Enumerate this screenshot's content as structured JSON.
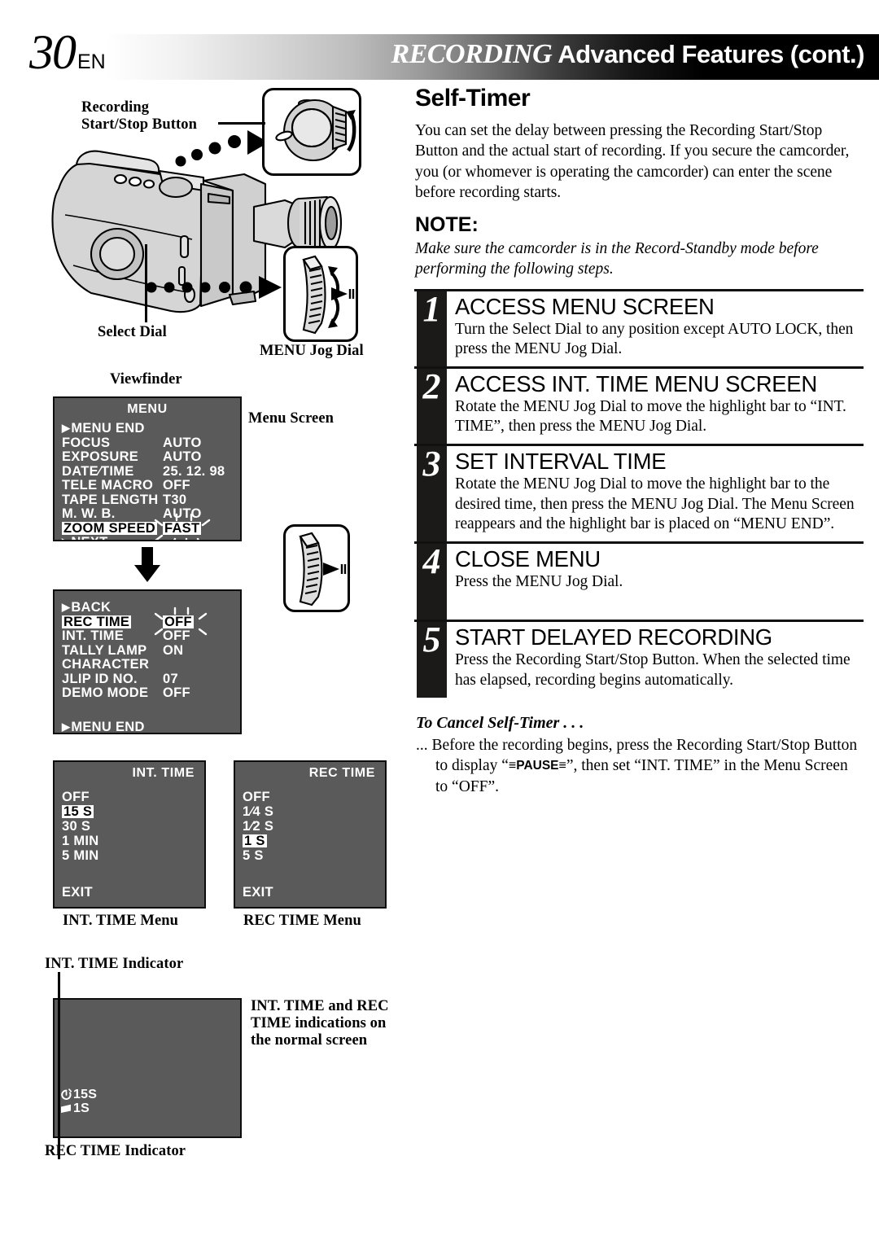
{
  "header": {
    "page_number": "30",
    "language": "EN",
    "title_italic": "RECORDING",
    "title_bold": "Advanced Features (cont.)"
  },
  "left": {
    "labels": {
      "recording_start_stop": "Recording\nStart/Stop Button",
      "select_dial": "Select Dial",
      "menu_jog_dial": "MENU Jog Dial",
      "viewfinder": "Viewfinder",
      "menu_screen": "Menu Screen",
      "int_time_menu": "INT. TIME Menu",
      "rec_time_menu": "REC TIME Menu",
      "int_time_indicator": "INT. TIME Indicator",
      "rec_time_indicator": "REC TIME Indicator",
      "normal_screen_note": "INT. TIME and REC TIME indications on the normal screen"
    }
  },
  "osd": {
    "menu1": {
      "title": "MENU",
      "rows": [
        {
          "name": "MENU END",
          "value": "",
          "arrow": true,
          "highlight": false,
          "blink": false
        },
        {
          "name": "FOCUS",
          "value": "AUTO",
          "arrow": false,
          "highlight": false,
          "blink": false
        },
        {
          "name": "EXPOSURE",
          "value": "AUTO",
          "arrow": false,
          "highlight": false,
          "blink": false
        },
        {
          "name": "DATE∕TIME",
          "value": "25. 12. 98",
          "arrow": false,
          "highlight": false,
          "blink": false
        },
        {
          "name": "TELE  MACRO",
          "value": "OFF",
          "arrow": false,
          "highlight": false,
          "blink": false
        },
        {
          "name": "TAPE  LENGTH",
          "value": "T30",
          "arrow": false,
          "highlight": false,
          "blink": false
        },
        {
          "name": "M. W. B.",
          "value": "AUTO",
          "arrow": false,
          "highlight": false,
          "blink": false
        },
        {
          "name": "ZOOM SPEED",
          "value": "FAST",
          "arrow": false,
          "highlight": true,
          "blink": true
        },
        {
          "name": "NEXT",
          "value": "",
          "arrow": true,
          "highlight": false,
          "blink": false
        }
      ]
    },
    "menu2": {
      "title": "",
      "rows": [
        {
          "name": "BACK",
          "value": "",
          "arrow": true,
          "highlight": false,
          "blink": false
        },
        {
          "name": "REC  TIME",
          "value": "OFF",
          "arrow": false,
          "highlight": true,
          "blink": true
        },
        {
          "name": "INT. TIME",
          "value": "OFF",
          "arrow": false,
          "highlight": false,
          "blink": false
        },
        {
          "name": "TALLY  LAMP",
          "value": "ON",
          "arrow": false,
          "highlight": false,
          "blink": false
        },
        {
          "name": "CHARACTER",
          "value": "",
          "arrow": false,
          "highlight": false,
          "blink": false
        },
        {
          "name": "JLIP ID NO.",
          "value": "07",
          "arrow": false,
          "highlight": false,
          "blink": false
        },
        {
          "name": "DEMO MODE",
          "value": "OFF",
          "arrow": false,
          "highlight": false,
          "blink": false
        }
      ],
      "footer": "MENU END"
    },
    "int_time": {
      "title": "INT. TIME",
      "items": [
        {
          "label": "OFF",
          "highlight": false
        },
        {
          "label": "15 S",
          "highlight": true
        },
        {
          "label": "30 S",
          "highlight": false
        },
        {
          "label": "1  MIN",
          "highlight": false
        },
        {
          "label": "5  MIN",
          "highlight": false
        }
      ],
      "exit": "EXIT"
    },
    "rec_time": {
      "title": "REC  TIME",
      "items": [
        {
          "label": "OFF",
          "highlight": false
        },
        {
          "label": "1∕4 S",
          "highlight": false
        },
        {
          "label": "1∕2 S",
          "highlight": false
        },
        {
          "label": "1  S",
          "highlight": true
        },
        {
          "label": "5  S",
          "highlight": false
        }
      ],
      "exit": "EXIT"
    },
    "normal_screen": {
      "int_value": "15S",
      "rec_value": "1S"
    }
  },
  "right": {
    "section_title": "Self-Timer",
    "intro": "You can set the delay between pressing the Recording Start/Stop Button and the actual start of recording. If you secure the camcorder, you (or whomever is operating the camcorder) can enter the scene before recording starts.",
    "note_heading": "NOTE:",
    "note_body": "Make sure the camcorder is in the Record-Standby mode before performing the following steps.",
    "steps": [
      {
        "number": "1",
        "title": "ACCESS MENU SCREEN",
        "body": "Turn the Select Dial to any position except AUTO LOCK, then press the MENU Jog Dial."
      },
      {
        "number": "2",
        "title": "ACCESS INT. TIME MENU SCREEN",
        "body": "Rotate the MENU Jog Dial to move the highlight bar to “INT. TIME”, then press the MENU Jog Dial."
      },
      {
        "number": "3",
        "title": "SET INTERVAL TIME",
        "body": "Rotate the MENU Jog Dial to move the highlight bar to the desired time, then press the MENU Jog Dial. The Menu Screen reappears and the highlight bar is placed on “MENU END”."
      },
      {
        "number": "4",
        "title": "CLOSE MENU",
        "body": "Press the MENU Jog Dial."
      },
      {
        "number": "5",
        "title": "START DELAYED RECORDING",
        "body": "Press the Recording Start/Stop Button. When the selected time has elapsed, recording begins automatically."
      }
    ],
    "cancel_heading": "To Cancel Self-Timer . . .",
    "cancel_body_part1": "... Before the recording begins, press the Recording Start/Stop Button to display “",
    "cancel_pause_label": "PAUSE",
    "cancel_body_part2": "”, then set “INT. TIME” in the Menu Screen to “OFF”."
  },
  "colors": {
    "osd_gray": "#5a5a5a",
    "step_bar_black": "#1c1a18",
    "ink": "#000000"
  }
}
